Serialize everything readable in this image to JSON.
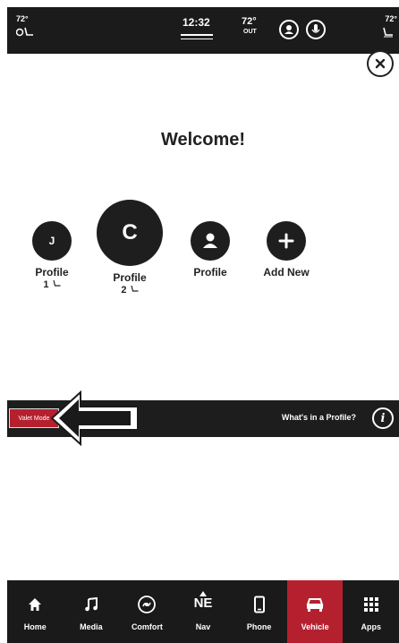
{
  "status_bar": {
    "left_temp": "72°",
    "clock": "12:32",
    "outside_temp": "72°",
    "outside_label": "OUT",
    "right_temp": "72°"
  },
  "welcome": {
    "title": "Welcome!",
    "profiles": [
      {
        "initial": "J",
        "label": "Profile",
        "sub": "1"
      },
      {
        "initial": "C",
        "label": "Profile",
        "sub": "2"
      },
      {
        "label": "Profile"
      },
      {
        "label": "Add New"
      }
    ]
  },
  "valet": {
    "button_label": "Valet Mode",
    "info_text": "What's in a Profile?",
    "info_icon": "i"
  },
  "nav": {
    "active": "Vehicle",
    "active_color": "#b5202f",
    "items": [
      {
        "label": "Home",
        "icon": "home-icon"
      },
      {
        "label": "Media",
        "icon": "music-note-icon"
      },
      {
        "label": "Comfort",
        "icon": "comfort-icon"
      },
      {
        "label": "Nav",
        "icon": "compass-icon",
        "heading": "NE"
      },
      {
        "label": "Phone",
        "icon": "phone-icon"
      },
      {
        "label": "Vehicle",
        "icon": "car-icon"
      },
      {
        "label": "Apps",
        "icon": "apps-grid-icon"
      }
    ]
  }
}
